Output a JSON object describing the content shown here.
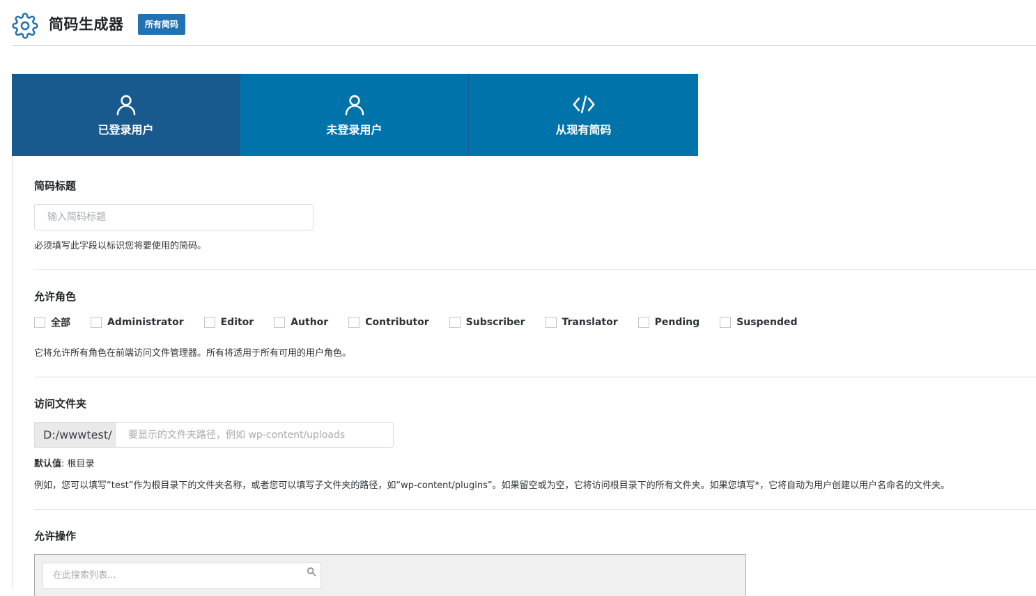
{
  "header": {
    "title": "简码生成器",
    "all_button": "所有简码",
    "icon": "gear-icon",
    "accent": "#2271b1"
  },
  "tabs": [
    {
      "label": "已登录用户",
      "icon": "user-icon",
      "active": true
    },
    {
      "label": "未登录用户",
      "icon": "user-icon",
      "active": false
    },
    {
      "label": "从现有简码",
      "icon": "code-icon",
      "active": false
    }
  ],
  "shortcode_title": {
    "label": "简码标题",
    "placeholder": "输入简码标题",
    "value": "",
    "help": "必须填写此字段以标识您将要使用的简码。"
  },
  "roles": {
    "label": "允许角色",
    "items": [
      "全部",
      "Administrator",
      "Editor",
      "Author",
      "Contributor",
      "Subscriber",
      "Translator",
      "Pending",
      "Suspended"
    ],
    "help": "它将允许所有角色在前端访问文件管理器。所有将适用于所有可用的用户角色。"
  },
  "folder": {
    "label": "访问文件夹",
    "prefix": "D:/wwwtest/",
    "placeholder": "要显示的文件夹路径，例如 wp-content/uploads",
    "default_label": "默认值",
    "default_value": ": 根目录",
    "help": "例如，您可以填写“test”作为根目录下的文件夹名称，或者您可以填写子文件夹的路径，如“wp-content/plugins”。如果留空或为空，它将访问根目录下的所有文件夹。如果您填写*，它将自动为用户创建以用户名命名的文件夹。"
  },
  "operations": {
    "label": "允许操作",
    "search_placeholder": "在此搜索列表..."
  },
  "colors": {
    "tab_bg": "#0073aa",
    "tab_active_bg": "#195a8e"
  }
}
